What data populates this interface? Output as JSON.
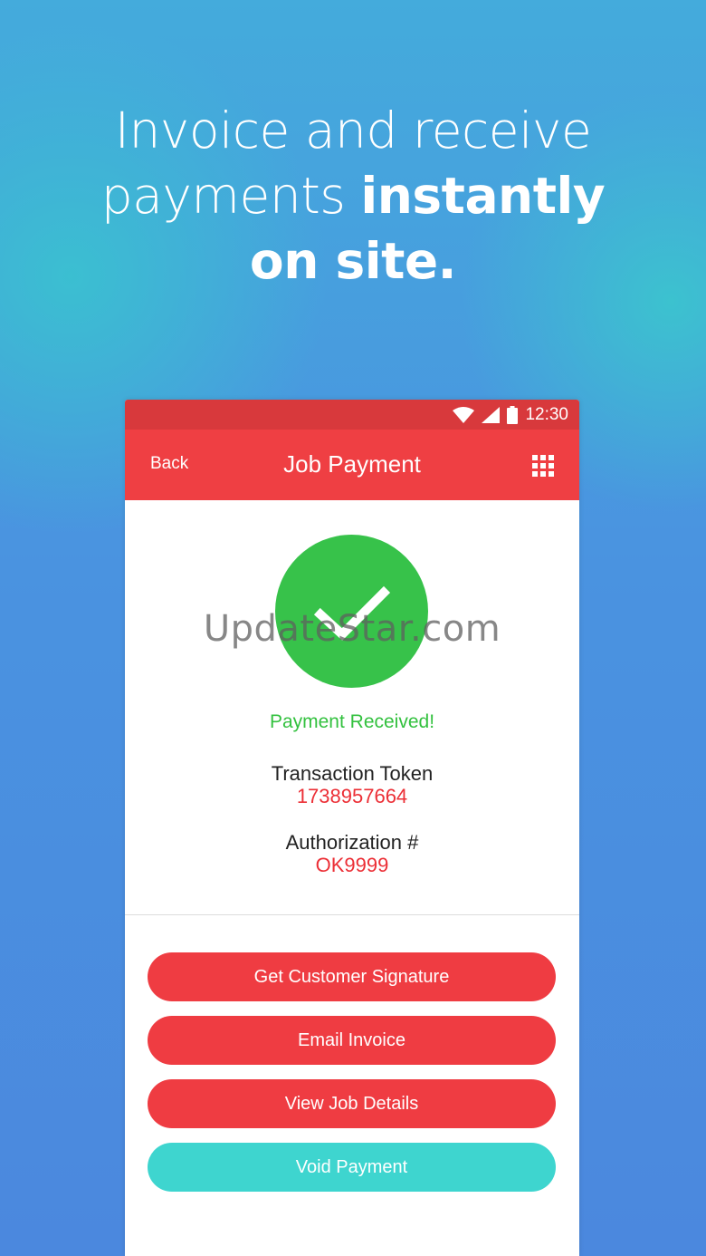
{
  "headline": {
    "line1": "Invoice and receive",
    "line2_light": "payments ",
    "line2_bold": "instantly",
    "line3_bold": "on site."
  },
  "statusbar": {
    "time": "12:30",
    "icons": [
      "wifi-icon",
      "signal-icon",
      "battery-icon"
    ]
  },
  "appbar": {
    "back_label": "Back",
    "title": "Job Payment",
    "menu_icon": "grid-icon"
  },
  "payment": {
    "status": "Payment Received!",
    "token_label": "Transaction Token",
    "token_value": "1738957664",
    "auth_label": "Authorization #",
    "auth_value": "OK9999"
  },
  "watermark": "UpdateStar.com",
  "actions": {
    "signature": "Get Customer Signature",
    "email": "Email Invoice",
    "details": "View Job Details",
    "void": "Void Payment"
  },
  "colors": {
    "primary": "#ef3f43",
    "statusbar": "#d8393c",
    "success": "#37c24a",
    "value": "#ec2f36",
    "void": "#3ed5cf"
  }
}
